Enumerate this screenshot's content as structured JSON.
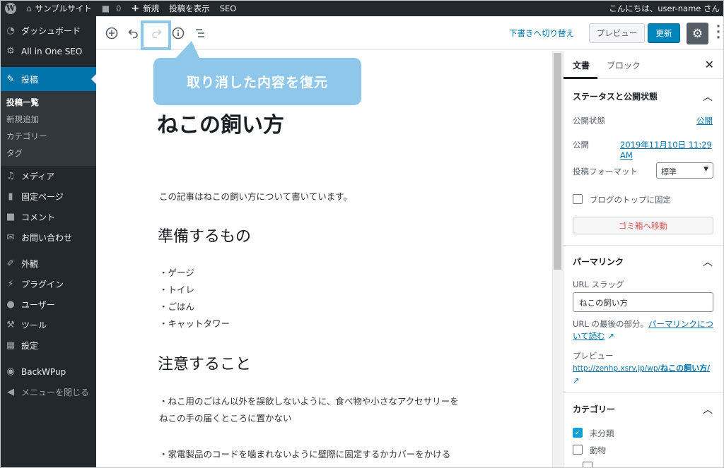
{
  "adminbar": {
    "site_name": "サンプルサイト",
    "comment_count": "0",
    "new_label": "新規",
    "view_post": "投稿を表示",
    "seo": "SEO",
    "greeting": "こんにちは、user-name さん"
  },
  "sidebar": {
    "dashboard": "ダッシュボード",
    "all_in_one_seo": "All in One SEO",
    "posts": "投稿",
    "posts_all": "投稿一覧",
    "posts_new": "新規追加",
    "posts_categories": "カテゴリー",
    "posts_tags": "タグ",
    "media": "メディア",
    "pages": "固定ページ",
    "comments": "コメント",
    "contact": "お問い合わせ",
    "appearance": "外観",
    "plugins": "プラグイン",
    "users": "ユーザー",
    "tools": "ツール",
    "settings": "設定",
    "backwpup": "BackWPup",
    "collapse": "メニューを閉じる"
  },
  "toolbar": {
    "switch_to_draft": "下書きへ切り替え",
    "preview": "プレビュー",
    "update": "更新"
  },
  "callout": {
    "text": "取り消した内容を復元"
  },
  "post": {
    "title": "ねこの飼い方",
    "intro": "この記事はねこの飼い方について書いています。",
    "heading1": "準備するもの",
    "list": [
      "・ゲージ",
      "・トイレ",
      "・ごはん",
      "・キャットタワー"
    ],
    "heading2": "注意すること",
    "para1_line1": "・ねこ用のごはん以外を誤飲しないように、食べ物や小さなアクセサリーを",
    "para1_line2": "ねこの手の届くところに置かない",
    "para2": "・家電製品のコードを噛まれないように壁際に固定するかカバーをかける"
  },
  "settings_panel": {
    "tab_document": "文書",
    "tab_block": "ブロック",
    "status_heading": "ステータスと公開状態",
    "visibility_label": "公開状態",
    "visibility_value": "公開",
    "publish_label": "公開",
    "publish_value": "2019年11月10日 11:29 AM",
    "format_label": "投稿フォーマット",
    "format_value": "標準",
    "sticky_label": "ブログのトップに固定",
    "trash_button": "ゴミ箱へ移動",
    "permalink_heading": "パーマリンク",
    "slug_label": "URL スラッグ",
    "slug_value": "ねこの飼い方",
    "url_tail_text": "URL の最後の部分。",
    "permalink_link_1": "パーマリンクにつ",
    "permalink_link_2": "いて読む",
    "preview_label": "プレビュー",
    "preview_url_prefix": "http://zenhp.xsrv.jp/wp/",
    "preview_url_slug": "ねこの飼い方/",
    "categories_heading": "カテゴリー",
    "category_1": "未分類",
    "category_2": "動物"
  }
}
